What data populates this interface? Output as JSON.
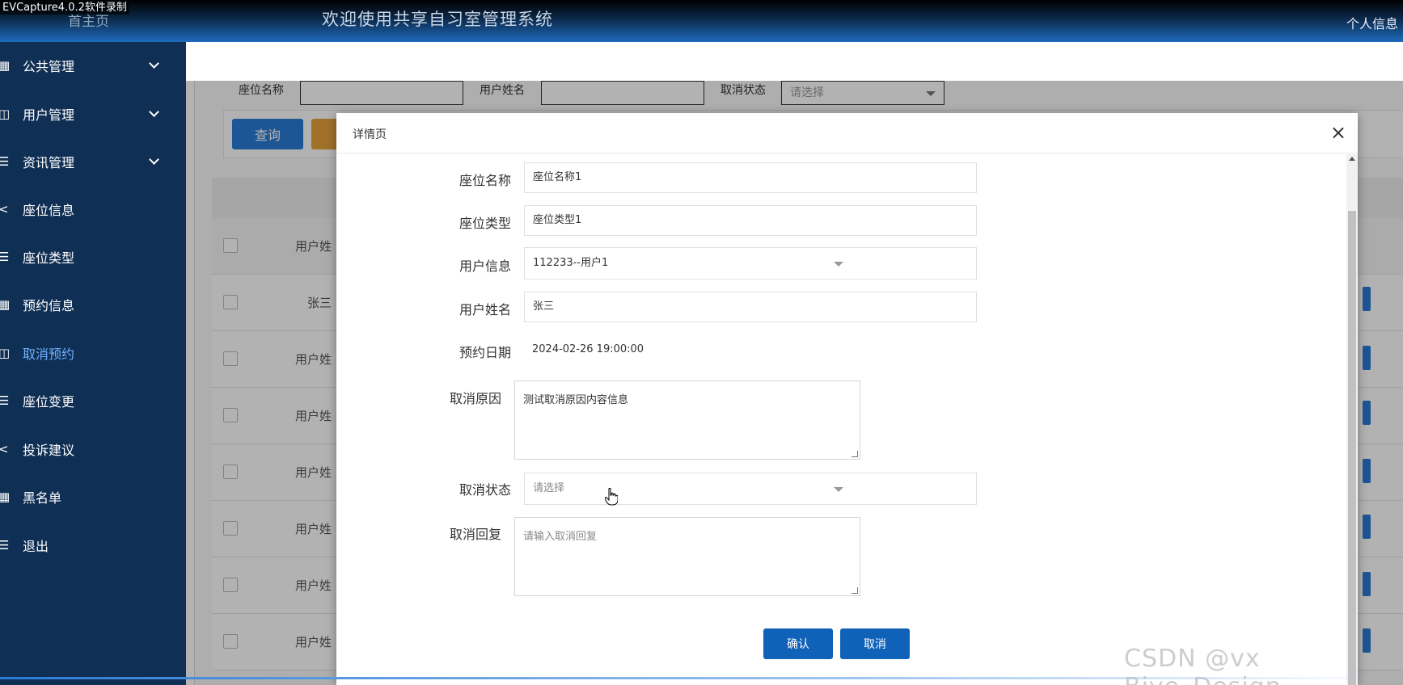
{
  "recorder": {
    "label": "EVCapture4.0.2软件录制"
  },
  "header": {
    "home": "首主页",
    "title": "欢迎使用共享自习室管理系统",
    "personal": "个人信息"
  },
  "sidebar": {
    "items": [
      {
        "label": "公共管理",
        "icon": "grid-icon",
        "has_submenu": true
      },
      {
        "label": "用户管理",
        "icon": "book-icon",
        "has_submenu": true
      },
      {
        "label": "资讯管理",
        "icon": "list-icon",
        "has_submenu": true
      },
      {
        "label": "座位信息",
        "icon": "share-icon",
        "has_submenu": false
      },
      {
        "label": "座位类型",
        "icon": "list-icon",
        "has_submenu": false
      },
      {
        "label": "预约信息",
        "icon": "grid-icon",
        "has_submenu": false
      },
      {
        "label": "取消预约",
        "icon": "book-icon",
        "has_submenu": false,
        "active": true
      },
      {
        "label": "座位变更",
        "icon": "list-icon",
        "has_submenu": false
      },
      {
        "label": "投诉建议",
        "icon": "share-icon",
        "has_submenu": false
      },
      {
        "label": "黑名单",
        "icon": "grid-icon",
        "has_submenu": false
      },
      {
        "label": "退出",
        "icon": "list-icon",
        "has_submenu": false
      }
    ]
  },
  "search": {
    "seat_name_label": "座位名称",
    "user_name_label": "用户姓名",
    "cancel_status_label": "取消状态",
    "cancel_status_placeholder": "请选择",
    "query_button": "查询"
  },
  "table": {
    "header_user": "用户姓",
    "rows": [
      "张三",
      "用户姓",
      "用户姓",
      "用户姓",
      "用户姓",
      "用户姓",
      "用户姓"
    ]
  },
  "dialog": {
    "title": "详情页",
    "close": "×",
    "fields": {
      "seat_name": {
        "label": "座位名称",
        "value": "座位名称1"
      },
      "seat_type": {
        "label": "座位类型",
        "value": "座位类型1"
      },
      "user_info": {
        "label": "用户信息",
        "value": "112233--用户1"
      },
      "user_name": {
        "label": "用户姓名",
        "value": "张三"
      },
      "booking_date": {
        "label": "预约日期",
        "value": "2024-02-26 19:00:00"
      },
      "cancel_reason": {
        "label": "取消原因",
        "value": "测试取消原因内容信息"
      },
      "cancel_status": {
        "label": "取消状态",
        "placeholder": "请选择"
      },
      "cancel_reply": {
        "label": "取消回复",
        "placeholder": "请输入取消回复"
      }
    },
    "confirm_button": "确认",
    "cancel_button": "取消"
  },
  "watermark": "CSDN @vx Biye_Design"
}
